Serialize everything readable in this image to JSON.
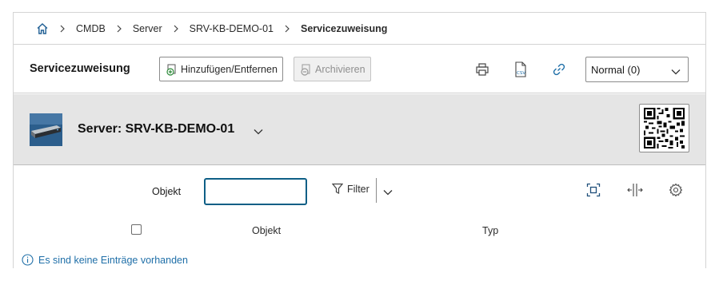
{
  "breadcrumb": {
    "home_icon": "home-icon",
    "items": [
      "CMDB",
      "Server",
      "SRV-KB-DEMO-01"
    ],
    "current": "Servicezuweisung"
  },
  "toolbar": {
    "title": "Servicezuweisung",
    "add_remove_label": "Hinzufügen/Entfernen",
    "archive_label": "Archivieren",
    "icons": [
      "printer-icon",
      "csv-export-icon",
      "link-icon"
    ],
    "view_select": {
      "value": "Normal (0)"
    }
  },
  "object": {
    "title": "Server: SRV-KB-DEMO-01",
    "image_icon": "server-icon",
    "qr_icon": "qr-code-icon"
  },
  "filter": {
    "label": "Objekt",
    "input_value": "",
    "filter_label": "Filter"
  },
  "table": {
    "columns": [
      "Objekt",
      "Typ"
    ]
  },
  "empty_message": "Es sind keine Einträge vorhanden",
  "colors": {
    "accent": "#0e5f86",
    "info": "#1f6fa8",
    "header_bg": "#e5e5e5"
  }
}
